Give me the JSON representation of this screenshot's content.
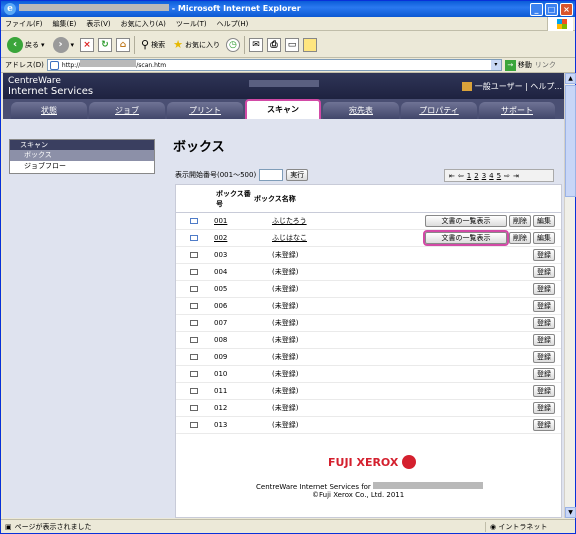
{
  "window": {
    "title": "Microsoft Internet Explorer"
  },
  "menubar": [
    "ファイル(F)",
    "編集(E)",
    "表示(V)",
    "お気に入り(A)",
    "ツール(T)",
    "ヘルプ(H)"
  ],
  "toolbar": {
    "back": "戻る",
    "search": "検索",
    "favorites": "お気に入り"
  },
  "address": {
    "label": "アドレス(D)",
    "url": "http://",
    "url_tail": "/scan.htm",
    "go": "移動",
    "links": "リンク"
  },
  "app": {
    "brand_line1": "CentreWare",
    "brand_line2": "Internet Services",
    "user_menu": "一般ユーザー | ヘルプ..."
  },
  "tabs": [
    "状態",
    "ジョブ",
    "プリント",
    "スキャン",
    "宛先表",
    "プロパティ",
    "サポート"
  ],
  "active_tab": "スキャン",
  "leftnav": {
    "section": "スキャン",
    "items": [
      "ボックス",
      "ジョブフロー"
    ]
  },
  "page": {
    "title": "ボックス",
    "start_label": "表示開始番号(001～500)",
    "run": "実行"
  },
  "pager": {
    "pages": [
      "1",
      "2",
      "3",
      "4",
      "5"
    ]
  },
  "table": {
    "headers": [
      "ボックス番号",
      "ボックス名称"
    ],
    "rows": [
      {
        "num": "001",
        "name": "ふじたろう",
        "registered": true
      },
      {
        "num": "002",
        "name": "ふじはなこ",
        "registered": true
      },
      {
        "num": "003",
        "name": "(未登録)",
        "registered": false
      },
      {
        "num": "004",
        "name": "(未登録)",
        "registered": false
      },
      {
        "num": "005",
        "name": "(未登録)",
        "registered": false
      },
      {
        "num": "006",
        "name": "(未登録)",
        "registered": false
      },
      {
        "num": "007",
        "name": "(未登録)",
        "registered": false
      },
      {
        "num": "008",
        "name": "(未登録)",
        "registered": false
      },
      {
        "num": "009",
        "name": "(未登録)",
        "registered": false
      },
      {
        "num": "010",
        "name": "(未登録)",
        "registered": false
      },
      {
        "num": "011",
        "name": "(未登録)",
        "registered": false
      },
      {
        "num": "012",
        "name": "(未登録)",
        "registered": false
      },
      {
        "num": "013",
        "name": "(未登録)",
        "registered": false
      }
    ],
    "btn_list": "文書の一覧表示",
    "btn_delete": "削除",
    "btn_edit": "編集",
    "btn_register": "登録"
  },
  "footer": {
    "logo": "FUJI XEROX",
    "line1": "CentreWare Internet Services for",
    "line2": "©Fuji Xerox Co., Ltd. 2011"
  },
  "status": {
    "text": "ページが表示されました",
    "zone": "イントラネット"
  }
}
